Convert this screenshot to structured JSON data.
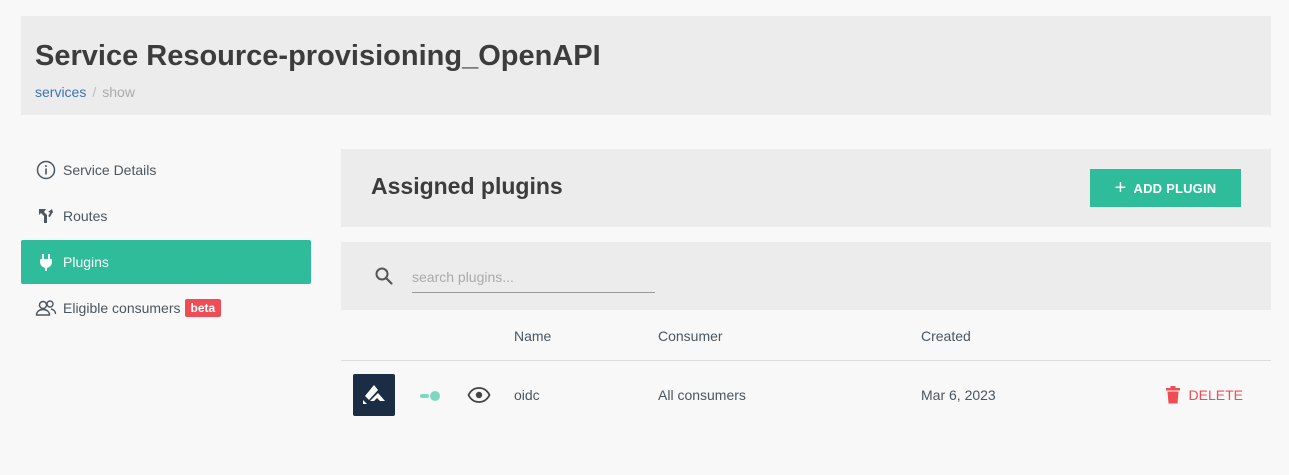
{
  "header": {
    "title": "Service Resource-provisioning_OpenAPI",
    "breadcrumb": {
      "link": "services",
      "separator": "/",
      "current": "show"
    }
  },
  "sidebar": {
    "items": [
      {
        "label": "Service Details",
        "icon": "info-circle-icon",
        "active": false
      },
      {
        "label": "Routes",
        "icon": "routes-icon",
        "active": false
      },
      {
        "label": "Plugins",
        "icon": "plug-icon",
        "active": true
      },
      {
        "label": "Eligible consumers",
        "icon": "users-icon",
        "active": false,
        "badge": "beta"
      }
    ]
  },
  "plugins_panel": {
    "title": "Assigned plugins",
    "add_button_label": "ADD PLUGIN",
    "search_placeholder": "search plugins..."
  },
  "table": {
    "columns": {
      "name": "Name",
      "consumer": "Consumer",
      "created": "Created"
    },
    "rows": [
      {
        "name": "oidc",
        "consumer": "All consumers",
        "created": "Mar 6, 2023",
        "enabled": true,
        "delete_label": "DELETE"
      }
    ]
  },
  "colors": {
    "accent": "#2fbc9a",
    "danger": "#ef4d55",
    "link": "#3b73b3",
    "logo_bg": "#1a2d44"
  }
}
